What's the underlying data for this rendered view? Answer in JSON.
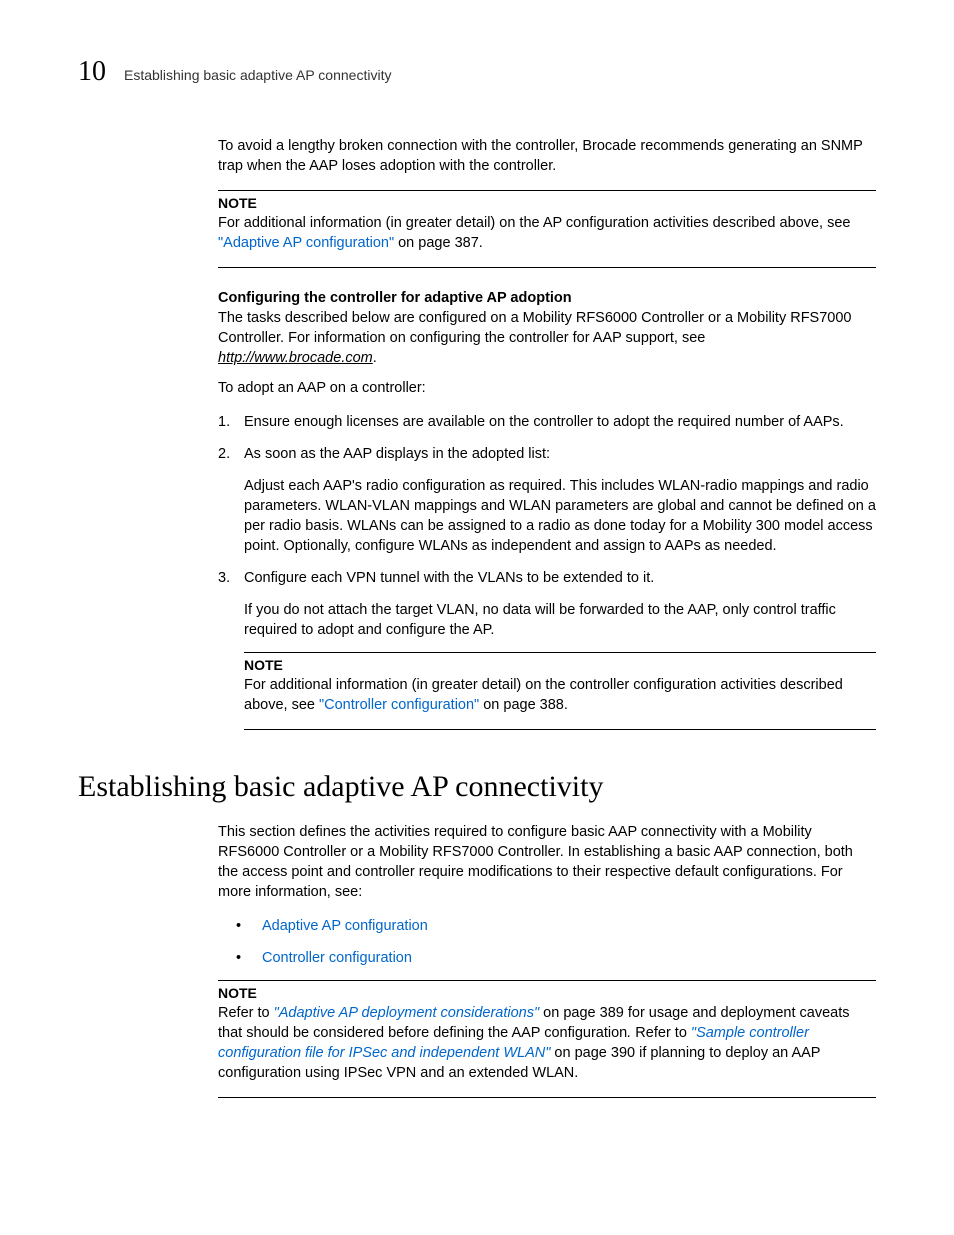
{
  "header": {
    "chapter_number": "10",
    "running_title": "Establishing basic adaptive AP connectivity"
  },
  "intro_para": "To avoid a lengthy broken connection with the controller, Brocade recommends generating an SNMP trap when the AAP loses adoption with the controller.",
  "note1": {
    "label": "NOTE",
    "text_before_link": "For additional information (in greater detail) on the AP configuration activities described above, see ",
    "link_text": "\"Adaptive AP configuration\"",
    "text_after_link": " on page 387."
  },
  "subhead1": "Configuring the controller for adaptive AP adoption",
  "config_para": {
    "text_before_link": "The tasks described below are configured on a Mobility RFS6000 Controller or a Mobility RFS7000 Controller. For information on configuring the controller for AAP support, see ",
    "url": "http://www.brocade.com",
    "text_after_link": "."
  },
  "adopt_lead": "To adopt an AAP on a controller:",
  "steps": [
    {
      "marker": "1.",
      "text": "Ensure enough licenses are available on the controller to adopt the required number of AAPs."
    },
    {
      "marker": "2.",
      "text": "As soon as the AAP displays in the adopted list:",
      "sub": "Adjust each AAP's radio configuration as required. This includes WLAN-radio mappings and radio parameters. WLAN-VLAN mappings and WLAN parameters are global and cannot be defined on a per radio basis. WLANs can be assigned to a radio as done today for a Mobility 300 model access point. Optionally, configure WLANs as independent and assign to AAPs as needed."
    },
    {
      "marker": "3.",
      "text": "Configure each VPN tunnel with the VLANs to be extended to it.",
      "sub": "If you do not attach the target VLAN, no data will be forwarded to the AAP, only control traffic required to adopt and configure the AP."
    }
  ],
  "note2": {
    "label": "NOTE",
    "text_before_link": "For additional information (in greater detail) on the controller configuration activities described above, see ",
    "link_text": "\"Controller configuration\"",
    "text_after_link": " on page 388."
  },
  "h1": "Establishing basic adaptive AP connectivity",
  "section_para": "This section defines the activities required to configure basic AAP connectivity with a Mobility RFS6000 Controller or a Mobility RFS7000 Controller. In establishing a basic AAP connection, both the access point and controller require modifications to their respective default configurations. For more information, see:",
  "bullets": [
    "Adaptive AP configuration",
    "Controller configuration"
  ],
  "note3": {
    "label": "NOTE",
    "t1": "Refer to ",
    "link1": "\"Adaptive AP deployment considerations\"",
    "t2": " on page 389 for usage and deployment caveats that should be considered before defining the AAP configuration",
    "period_italic": ".",
    "t3": " Refer to ",
    "link2": "\"Sample controller configuration file for IPSec and independent WLAN\"",
    "t4": " on page 390 if planning to deploy an AAP configuration using IPSec VPN and an extended WLAN."
  }
}
